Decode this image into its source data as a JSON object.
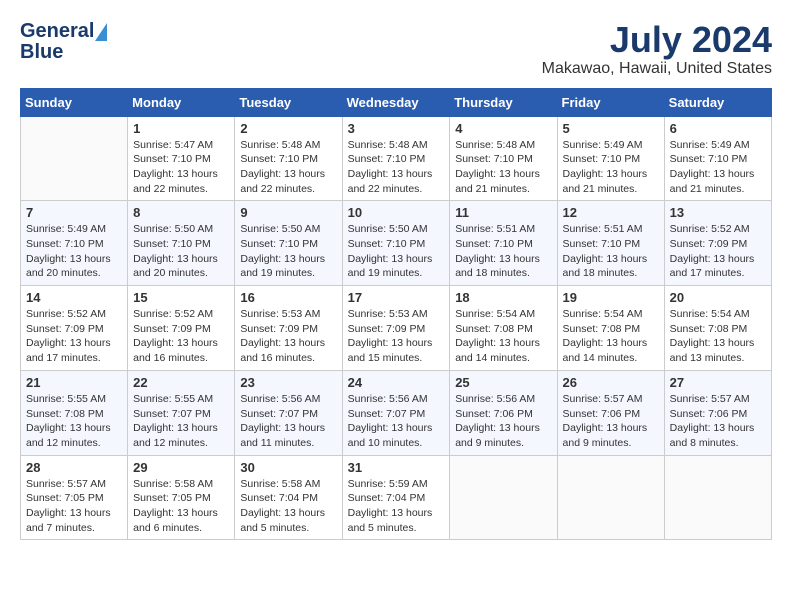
{
  "header": {
    "logo_general": "General",
    "logo_blue": "Blue",
    "title": "July 2024",
    "subtitle": "Makawao, Hawaii, United States"
  },
  "calendar": {
    "days_of_week": [
      "Sunday",
      "Monday",
      "Tuesday",
      "Wednesday",
      "Thursday",
      "Friday",
      "Saturday"
    ],
    "weeks": [
      [
        {
          "day": "",
          "sunrise": "",
          "sunset": "",
          "daylight": ""
        },
        {
          "day": "1",
          "sunrise": "Sunrise: 5:47 AM",
          "sunset": "Sunset: 7:10 PM",
          "daylight": "Daylight: 13 hours and 22 minutes."
        },
        {
          "day": "2",
          "sunrise": "Sunrise: 5:48 AM",
          "sunset": "Sunset: 7:10 PM",
          "daylight": "Daylight: 13 hours and 22 minutes."
        },
        {
          "day": "3",
          "sunrise": "Sunrise: 5:48 AM",
          "sunset": "Sunset: 7:10 PM",
          "daylight": "Daylight: 13 hours and 22 minutes."
        },
        {
          "day": "4",
          "sunrise": "Sunrise: 5:48 AM",
          "sunset": "Sunset: 7:10 PM",
          "daylight": "Daylight: 13 hours and 21 minutes."
        },
        {
          "day": "5",
          "sunrise": "Sunrise: 5:49 AM",
          "sunset": "Sunset: 7:10 PM",
          "daylight": "Daylight: 13 hours and 21 minutes."
        },
        {
          "day": "6",
          "sunrise": "Sunrise: 5:49 AM",
          "sunset": "Sunset: 7:10 PM",
          "daylight": "Daylight: 13 hours and 21 minutes."
        }
      ],
      [
        {
          "day": "7",
          "sunrise": "Sunrise: 5:49 AM",
          "sunset": "Sunset: 7:10 PM",
          "daylight": "Daylight: 13 hours and 20 minutes."
        },
        {
          "day": "8",
          "sunrise": "Sunrise: 5:50 AM",
          "sunset": "Sunset: 7:10 PM",
          "daylight": "Daylight: 13 hours and 20 minutes."
        },
        {
          "day": "9",
          "sunrise": "Sunrise: 5:50 AM",
          "sunset": "Sunset: 7:10 PM",
          "daylight": "Daylight: 13 hours and 19 minutes."
        },
        {
          "day": "10",
          "sunrise": "Sunrise: 5:50 AM",
          "sunset": "Sunset: 7:10 PM",
          "daylight": "Daylight: 13 hours and 19 minutes."
        },
        {
          "day": "11",
          "sunrise": "Sunrise: 5:51 AM",
          "sunset": "Sunset: 7:10 PM",
          "daylight": "Daylight: 13 hours and 18 minutes."
        },
        {
          "day": "12",
          "sunrise": "Sunrise: 5:51 AM",
          "sunset": "Sunset: 7:10 PM",
          "daylight": "Daylight: 13 hours and 18 minutes."
        },
        {
          "day": "13",
          "sunrise": "Sunrise: 5:52 AM",
          "sunset": "Sunset: 7:09 PM",
          "daylight": "Daylight: 13 hours and 17 minutes."
        }
      ],
      [
        {
          "day": "14",
          "sunrise": "Sunrise: 5:52 AM",
          "sunset": "Sunset: 7:09 PM",
          "daylight": "Daylight: 13 hours and 17 minutes."
        },
        {
          "day": "15",
          "sunrise": "Sunrise: 5:52 AM",
          "sunset": "Sunset: 7:09 PM",
          "daylight": "Daylight: 13 hours and 16 minutes."
        },
        {
          "day": "16",
          "sunrise": "Sunrise: 5:53 AM",
          "sunset": "Sunset: 7:09 PM",
          "daylight": "Daylight: 13 hours and 16 minutes."
        },
        {
          "day": "17",
          "sunrise": "Sunrise: 5:53 AM",
          "sunset": "Sunset: 7:09 PM",
          "daylight": "Daylight: 13 hours and 15 minutes."
        },
        {
          "day": "18",
          "sunrise": "Sunrise: 5:54 AM",
          "sunset": "Sunset: 7:08 PM",
          "daylight": "Daylight: 13 hours and 14 minutes."
        },
        {
          "day": "19",
          "sunrise": "Sunrise: 5:54 AM",
          "sunset": "Sunset: 7:08 PM",
          "daylight": "Daylight: 13 hours and 14 minutes."
        },
        {
          "day": "20",
          "sunrise": "Sunrise: 5:54 AM",
          "sunset": "Sunset: 7:08 PM",
          "daylight": "Daylight: 13 hours and 13 minutes."
        }
      ],
      [
        {
          "day": "21",
          "sunrise": "Sunrise: 5:55 AM",
          "sunset": "Sunset: 7:08 PM",
          "daylight": "Daylight: 13 hours and 12 minutes."
        },
        {
          "day": "22",
          "sunrise": "Sunrise: 5:55 AM",
          "sunset": "Sunset: 7:07 PM",
          "daylight": "Daylight: 13 hours and 12 minutes."
        },
        {
          "day": "23",
          "sunrise": "Sunrise: 5:56 AM",
          "sunset": "Sunset: 7:07 PM",
          "daylight": "Daylight: 13 hours and 11 minutes."
        },
        {
          "day": "24",
          "sunrise": "Sunrise: 5:56 AM",
          "sunset": "Sunset: 7:07 PM",
          "daylight": "Daylight: 13 hours and 10 minutes."
        },
        {
          "day": "25",
          "sunrise": "Sunrise: 5:56 AM",
          "sunset": "Sunset: 7:06 PM",
          "daylight": "Daylight: 13 hours and 9 minutes."
        },
        {
          "day": "26",
          "sunrise": "Sunrise: 5:57 AM",
          "sunset": "Sunset: 7:06 PM",
          "daylight": "Daylight: 13 hours and 9 minutes."
        },
        {
          "day": "27",
          "sunrise": "Sunrise: 5:57 AM",
          "sunset": "Sunset: 7:06 PM",
          "daylight": "Daylight: 13 hours and 8 minutes."
        }
      ],
      [
        {
          "day": "28",
          "sunrise": "Sunrise: 5:57 AM",
          "sunset": "Sunset: 7:05 PM",
          "daylight": "Daylight: 13 hours and 7 minutes."
        },
        {
          "day": "29",
          "sunrise": "Sunrise: 5:58 AM",
          "sunset": "Sunset: 7:05 PM",
          "daylight": "Daylight: 13 hours and 6 minutes."
        },
        {
          "day": "30",
          "sunrise": "Sunrise: 5:58 AM",
          "sunset": "Sunset: 7:04 PM",
          "daylight": "Daylight: 13 hours and 5 minutes."
        },
        {
          "day": "31",
          "sunrise": "Sunrise: 5:59 AM",
          "sunset": "Sunset: 7:04 PM",
          "daylight": "Daylight: 13 hours and 5 minutes."
        },
        {
          "day": "",
          "sunrise": "",
          "sunset": "",
          "daylight": ""
        },
        {
          "day": "",
          "sunrise": "",
          "sunset": "",
          "daylight": ""
        },
        {
          "day": "",
          "sunrise": "",
          "sunset": "",
          "daylight": ""
        }
      ]
    ]
  }
}
